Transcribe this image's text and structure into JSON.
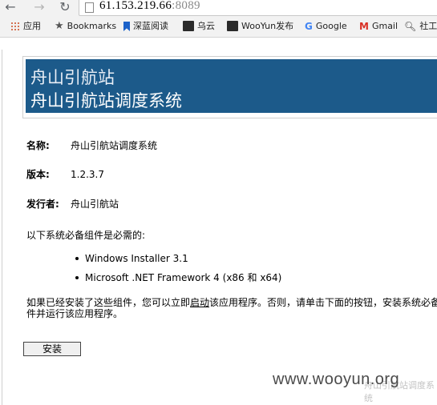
{
  "browser": {
    "url_host": "61.153.219.66",
    "url_port": ":8089",
    "bookmarks": [
      "应用",
      "Bookmarks",
      "深蓝阅读",
      "乌云",
      "WooYun发布",
      "Google",
      "Gmail",
      "社工"
    ]
  },
  "header": {
    "subtitle": "舟山引航站",
    "title": "舟山引航站调度系统"
  },
  "details": {
    "name_label": "名称:",
    "name_value": "舟山引航站调度系统",
    "version_label": "版本:",
    "version_value": "1.2.3.7",
    "publisher_label": "发行者:",
    "publisher_value": "舟山引航站"
  },
  "prerequisites": {
    "intro": "以下系统必备组件是必需的:",
    "items": [
      "Windows Installer 3.1",
      "Microsoft .NET Framework 4 (x86 和 x64)"
    ]
  },
  "instructions": {
    "line1_before": "如果已经安装了这些组件，您可以立即",
    "link": "启动",
    "line1_after": "该应用程序。否则，请单击下面的按钮，安装系统必备",
    "line2": "件并运行该应用程序。"
  },
  "install_button": "安装",
  "watermark": "www.wooyun.org",
  "watermark_ghost": "舟山引航站调度系统"
}
